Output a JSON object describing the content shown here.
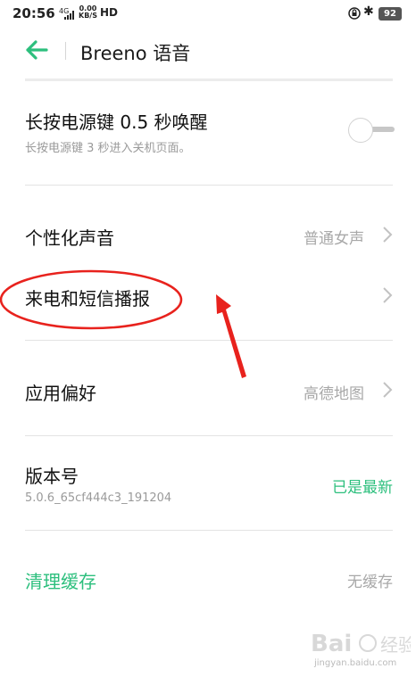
{
  "status_bar": {
    "time": "20:56",
    "signal": "4G",
    "net_speed_value": "0.00",
    "net_speed_unit": "KB/S",
    "hd": "HD",
    "battery": "92"
  },
  "header": {
    "title": "Breeno 语音"
  },
  "settings": {
    "power_wake": {
      "title": "长按电源键 0.5 秒唤醒",
      "subtitle": "长按电源键 3 秒进入关机页面。",
      "toggle_on": false
    },
    "voice": {
      "title": "个性化声音",
      "value": "普通女声"
    },
    "call_sms": {
      "title": "来电和短信播报"
    },
    "app_pref": {
      "title": "应用偏好",
      "value": "高德地图"
    },
    "version": {
      "title": "版本号",
      "subtitle": "5.0.6_65cf444c3_191204",
      "value": "已是最新"
    },
    "clear_cache": {
      "title": "清理缓存",
      "value": "无缓存"
    }
  },
  "watermark": {
    "text": "jingyan.baidu.com"
  },
  "colors": {
    "accent": "#2cbf7d",
    "annotation": "#e8221d"
  }
}
